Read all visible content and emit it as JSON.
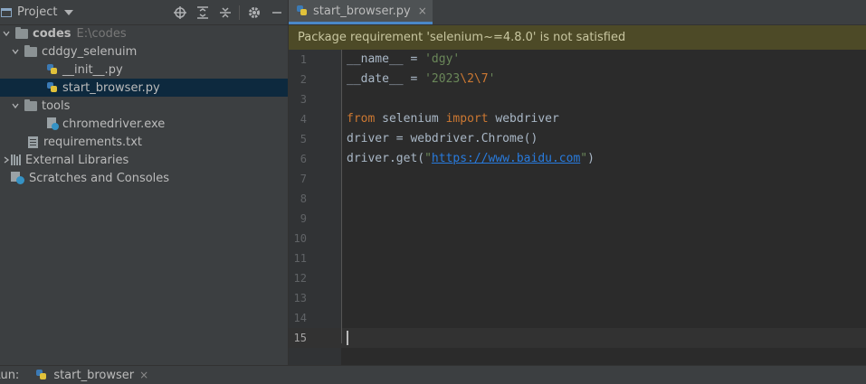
{
  "project_panel": {
    "title": "Project",
    "tree": {
      "root_name": "codes",
      "root_path": "E:\\codes",
      "package_name": "cddgy_selenuim",
      "file_init": "__init__.py",
      "file_start_browser": "start_browser.py",
      "tools_folder": "tools",
      "file_chromedriver": "chromedriver.exe",
      "file_requirements": "requirements.txt",
      "external_libraries": "External Libraries",
      "scratches": "Scratches and Consoles"
    }
  },
  "editor": {
    "tab_label": "start_browser.py",
    "tab_close": "×",
    "warning": "Package requirement 'selenium~=4.8.0' is not satisfied",
    "line_numbers": [
      "1",
      "2",
      "3",
      "4",
      "5",
      "6",
      "7",
      "8",
      "9",
      "10",
      "11",
      "12",
      "13",
      "14",
      "15"
    ],
    "current_line": 15,
    "code": {
      "l1_name": "__name__",
      "l1_op": " = ",
      "l1_val": "'dgy'",
      "l2_name": "__date__",
      "l2_op": " = ",
      "l2_pre": "'2023",
      "l2_esc1": "\\2",
      "l2_esc2": "\\7",
      "l2_post": "'",
      "l4_from": "from",
      "l4_mod": " selenium ",
      "l4_import": "import",
      "l4_name": " webdriver",
      "l5": "driver = webdriver.Chrome()",
      "l6_pre": "driver.get(",
      "l6_q1": "\"",
      "l6_url": "https://www.baidu.com",
      "l6_q2": "\"",
      "l6_post": ")"
    }
  },
  "run_bar": {
    "label": "Run:",
    "tab": "start_browser",
    "close": "×"
  },
  "colors": {
    "keyword": "#cc7832",
    "string": "#6a8759",
    "url": "#287bde",
    "selection": "#0d293e",
    "warning_bg": "#4d4a27"
  }
}
